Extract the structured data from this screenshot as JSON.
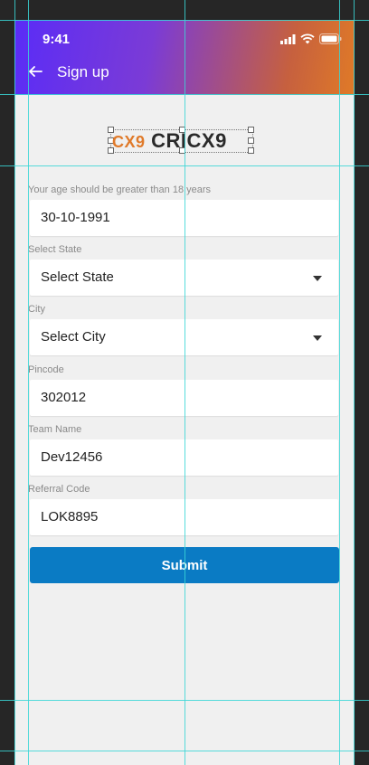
{
  "status_bar": {
    "time": "9:41"
  },
  "header": {
    "title": "Sign up",
    "gradient_colors": [
      "#5a2cf7",
      "#e07a27"
    ]
  },
  "logo": {
    "mark": "CX9",
    "name": "CRICX9",
    "mark_color": "#e07a2a"
  },
  "form": {
    "age_label": "Your age should be greater than 18 years",
    "dob_value": "30-10-1991",
    "state_label": "Select State",
    "state_value": "Select State",
    "city_label": "City",
    "city_value": "Select City",
    "pincode_label": "Pincode",
    "pincode_value": "302012",
    "team_label": "Team Name",
    "team_value": "Dev12456",
    "referral_label": "Referral Code",
    "referral_value": "LOK8895",
    "submit_label": "Submit",
    "submit_color": "#0a7bc4"
  }
}
